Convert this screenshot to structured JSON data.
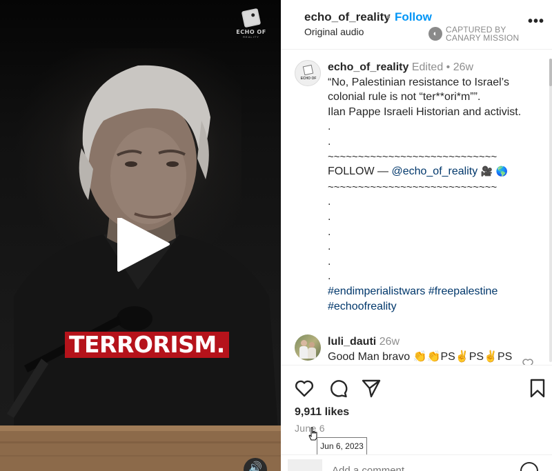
{
  "video": {
    "caption_word": "TERRORISM.",
    "watermark_text": "ECHO OF",
    "watermark_sub": "REALITY"
  },
  "header": {
    "username": "echo_of_reality",
    "separator": "•",
    "follow_label": "Follow",
    "audio_label": "Original audio",
    "canary_line1": "CAPTURED BY",
    "canary_line2": "CANARY MISSION",
    "more_label": "•••"
  },
  "post": {
    "username": "echo_of_reality",
    "edited_label": "Edited",
    "dot": "•",
    "age": "26w",
    "quote": "“No, Palestinian resistance to Israel’s colonial rule is not “ter**ori*m””.",
    "attribution": "Ilan Pappe Israeli Historian and activist.",
    "dot_line": ".",
    "tilde_line": "~~~~~~~~~~~~~~~~~~~~~~~~~~~~",
    "follow_prefix": "FOLLOW — ",
    "follow_mention": "@echo_of_reality",
    "follow_emojis": "🎥 🌎",
    "hashtags_line1": "#endimperialistwars #freepalestine",
    "hashtags_line2": "#echoofreality"
  },
  "comment": {
    "username": "luli_dauti",
    "age": "26w",
    "text": "Good Man bravo 👏👏PS✌️PS✌️PS"
  },
  "actions": {
    "likes": "9,911 likes",
    "date": "June 6",
    "tooltip": "Jun 6, 2023",
    "add_comment_placeholder": "Add a comment…"
  },
  "colors": {
    "link_blue": "#0095f6",
    "hashtag_blue": "#00376b",
    "muted_gray": "#8e8e8e",
    "caption_red": "#b5131b"
  }
}
